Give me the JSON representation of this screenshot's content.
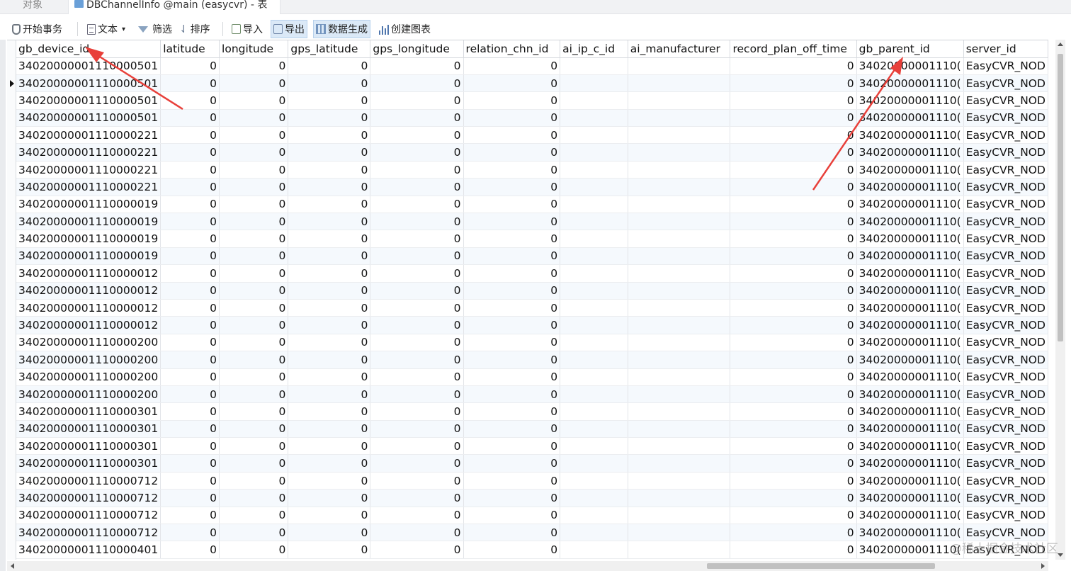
{
  "tabs": {
    "inactive_label": "对象",
    "active_label": "DBChannelInfo @main (easycvr) - 表"
  },
  "toolbar": {
    "begin_transaction": "开始事务",
    "text": "文本",
    "filter": "筛选",
    "sort": "排序",
    "import": "导入",
    "export": "导出",
    "generate_data": "数据生成",
    "create_chart": "创建图表"
  },
  "table": {
    "columns": [
      "gb_device_id",
      "latitude",
      "longitude",
      "gps_latitude",
      "gps_longitude",
      "relation_chn_id",
      "ai_ip_c_id",
      "ai_manufacturer",
      "record_plan_off_time",
      "gb_parent_id",
      "server_id"
    ],
    "current_row_index": 1,
    "rows": [
      [
        "34020000001110000501",
        "0",
        "0",
        "0",
        "0",
        "0",
        "",
        "",
        "0",
        "34020000001110(",
        "EasyCVR_NOD"
      ],
      [
        "34020000001110000501",
        "0",
        "0",
        "0",
        "0",
        "0",
        "",
        "",
        "0",
        "34020000001110(",
        "EasyCVR_NOD"
      ],
      [
        "34020000001110000501",
        "0",
        "0",
        "0",
        "0",
        "0",
        "",
        "",
        "0",
        "34020000001110(",
        "EasyCVR_NOD"
      ],
      [
        "34020000001110000501",
        "0",
        "0",
        "0",
        "0",
        "0",
        "",
        "",
        "0",
        "34020000001110(",
        "EasyCVR_NOD"
      ],
      [
        "34020000001110000221",
        "0",
        "0",
        "0",
        "0",
        "0",
        "",
        "",
        "0",
        "34020000001110(",
        "EasyCVR_NOD"
      ],
      [
        "34020000001110000221",
        "0",
        "0",
        "0",
        "0",
        "0",
        "",
        "",
        "0",
        "34020000001110(",
        "EasyCVR_NOD"
      ],
      [
        "34020000001110000221",
        "0",
        "0",
        "0",
        "0",
        "0",
        "",
        "",
        "0",
        "34020000001110(",
        "EasyCVR_NOD"
      ],
      [
        "34020000001110000221",
        "0",
        "0",
        "0",
        "0",
        "0",
        "",
        "",
        "0",
        "34020000001110(",
        "EasyCVR_NOD"
      ],
      [
        "34020000001110000019",
        "0",
        "0",
        "0",
        "0",
        "0",
        "",
        "",
        "0",
        "34020000001110(",
        "EasyCVR_NOD"
      ],
      [
        "34020000001110000019",
        "0",
        "0",
        "0",
        "0",
        "0",
        "",
        "",
        "0",
        "34020000001110(",
        "EasyCVR_NOD"
      ],
      [
        "34020000001110000019",
        "0",
        "0",
        "0",
        "0",
        "0",
        "",
        "",
        "0",
        "34020000001110(",
        "EasyCVR_NOD"
      ],
      [
        "34020000001110000019",
        "0",
        "0",
        "0",
        "0",
        "0",
        "",
        "",
        "0",
        "34020000001110(",
        "EasyCVR_NOD"
      ],
      [
        "34020000001110000012",
        "0",
        "0",
        "0",
        "0",
        "0",
        "",
        "",
        "0",
        "34020000001110(",
        "EasyCVR_NOD"
      ],
      [
        "34020000001110000012",
        "0",
        "0",
        "0",
        "0",
        "0",
        "",
        "",
        "0",
        "34020000001110(",
        "EasyCVR_NOD"
      ],
      [
        "34020000001110000012",
        "0",
        "0",
        "0",
        "0",
        "0",
        "",
        "",
        "0",
        "34020000001110(",
        "EasyCVR_NOD"
      ],
      [
        "34020000001110000012",
        "0",
        "0",
        "0",
        "0",
        "0",
        "",
        "",
        "0",
        "34020000001110(",
        "EasyCVR_NOD"
      ],
      [
        "34020000001110000200",
        "0",
        "0",
        "0",
        "0",
        "0",
        "",
        "",
        "0",
        "34020000001110(",
        "EasyCVR_NOD"
      ],
      [
        "34020000001110000200",
        "0",
        "0",
        "0",
        "0",
        "0",
        "",
        "",
        "0",
        "34020000001110(",
        "EasyCVR_NOD"
      ],
      [
        "34020000001110000200",
        "0",
        "0",
        "0",
        "0",
        "0",
        "",
        "",
        "0",
        "34020000001110(",
        "EasyCVR_NOD"
      ],
      [
        "34020000001110000200",
        "0",
        "0",
        "0",
        "0",
        "0",
        "",
        "",
        "0",
        "34020000001110(",
        "EasyCVR_NOD"
      ],
      [
        "34020000001110000301",
        "0",
        "0",
        "0",
        "0",
        "0",
        "",
        "",
        "0",
        "34020000001110(",
        "EasyCVR_NOD"
      ],
      [
        "34020000001110000301",
        "0",
        "0",
        "0",
        "0",
        "0",
        "",
        "",
        "0",
        "34020000001110(",
        "EasyCVR_NOD"
      ],
      [
        "34020000001110000301",
        "0",
        "0",
        "0",
        "0",
        "0",
        "",
        "",
        "0",
        "34020000001110(",
        "EasyCVR_NOD"
      ],
      [
        "34020000001110000301",
        "0",
        "0",
        "0",
        "0",
        "0",
        "",
        "",
        "0",
        "34020000001110(",
        "EasyCVR_NOD"
      ],
      [
        "34020000001110000712",
        "0",
        "0",
        "0",
        "0",
        "0",
        "",
        "",
        "0",
        "34020000001110(",
        "EasyCVR_NOD"
      ],
      [
        "34020000001110000712",
        "0",
        "0",
        "0",
        "0",
        "0",
        "",
        "",
        "0",
        "34020000001110(",
        "EasyCVR_NOD"
      ],
      [
        "34020000001110000712",
        "0",
        "0",
        "0",
        "0",
        "0",
        "",
        "",
        "0",
        "34020000001110(",
        "EasyCVR_NOD"
      ],
      [
        "34020000001110000712",
        "0",
        "0",
        "0",
        "0",
        "0",
        "",
        "",
        "0",
        "34020000001110(",
        "EasyCVR_NOD"
      ],
      [
        "34020000001110000401",
        "0",
        "0",
        "0",
        "0",
        "0",
        "",
        "",
        "0",
        "34020000001110(",
        "EasyCVR_NOD"
      ]
    ]
  },
  "annotation_color": "#e8403a",
  "watermark": "@稀土掘金技术社区"
}
